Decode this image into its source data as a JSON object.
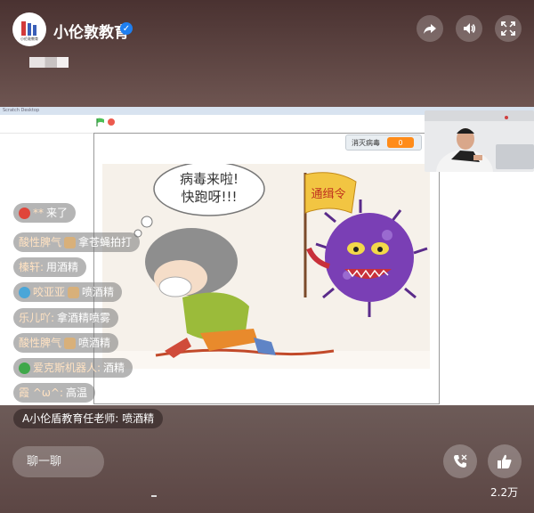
{
  "header": {
    "channel_name": "小伦敦教育",
    "logo_text": "小伦敦教育",
    "verified": true,
    "controls": [
      "share-icon",
      "volume-icon",
      "fullscreen-icon"
    ]
  },
  "stream": {
    "scratch_title": "Scratch Desktop",
    "variable_monitor": {
      "label": "消灭病毒",
      "value": "0"
    },
    "art": {
      "speech_bubble": [
        "病毒来啦!",
        "快跑呀!!!"
      ],
      "flag_text": "通缉令"
    }
  },
  "chat": [
    {
      "emoji": "strawberry-icon",
      "name": "** ",
      "message": "来了"
    },
    {
      "emoji": "",
      "name": "酸性脾气",
      "badge": "fan-badge-icon",
      "message": "拿苍蝇拍打"
    },
    {
      "emoji": "",
      "name": "榛轩:",
      "message": "用酒精"
    },
    {
      "emoji": "dolphin-icon",
      "name": "咬亚亚",
      "badge": "fan-badge-icon",
      "message": "喷酒精"
    },
    {
      "emoji": "",
      "name": "乐儿吖:",
      "message": "拿酒精喷雾"
    },
    {
      "emoji": "",
      "name": "酸性脾气",
      "badge": "fan-badge-icon",
      "message": "喷酒精"
    },
    {
      "emoji": "clover-icon",
      "name": "爱克斯机器人:",
      "message": "酒精"
    },
    {
      "emoji": "",
      "name": "霞 ^ω^:",
      "message": "高温"
    }
  ],
  "announcement": {
    "name": "A小伦盾教育任老师:",
    "message": "喷酒精"
  },
  "bottom": {
    "input_placeholder": "聊一聊",
    "like_count": "2.2万"
  }
}
